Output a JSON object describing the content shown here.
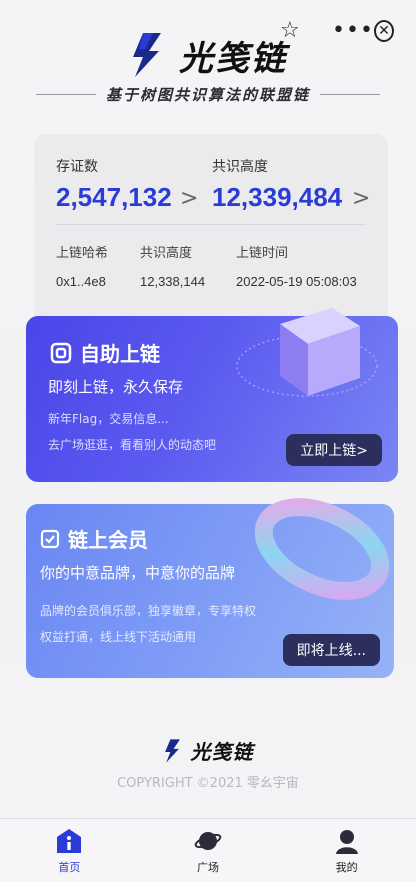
{
  "topbar": {
    "menu_glyph": "•••",
    "close_glyph": "✕"
  },
  "brand": {
    "title": "光笺链",
    "slogan": "基于树图共识算法的联盟链"
  },
  "stats": {
    "cert_label": "存证数",
    "cert_value": "2,547,132",
    "height_label": "共识高度",
    "height_value": "12,339,484",
    "arrow": ">",
    "table": {
      "headers": [
        "上链哈希",
        "共识高度",
        "上链时间"
      ],
      "values": [
        "0x1..4e8",
        "12,338,144",
        "2022-05-19 05:08:03"
      ]
    }
  },
  "card_self": {
    "title": "自助上链",
    "subtitle": "即刻上链，永久保存",
    "desc1": "新年Flag，交易信息...",
    "desc2": "去广场逛逛，看看别人的动态吧",
    "button": "立即上链>"
  },
  "card_member": {
    "title": "链上会员",
    "subtitle": "你的中意品牌，中意你的品牌",
    "desc1": "品牌的会员俱乐部，独享徽章，专享特权",
    "desc2": "权益打通，线上线下活动通用",
    "button": "即将上线..."
  },
  "footer": {
    "title": "光笺链",
    "copyright": "COPYRIGHT ©2021 零幺宇宙"
  },
  "tabs": [
    {
      "label": "首页",
      "icon": "home-info-icon",
      "active": true
    },
    {
      "label": "广场",
      "icon": "planet-icon",
      "active": false
    },
    {
      "label": "我的",
      "icon": "user-icon",
      "active": false
    }
  ],
  "colors": {
    "accent": "#2a3bd6",
    "card1": "#4a45e8",
    "card2": "#7e9cf6"
  }
}
